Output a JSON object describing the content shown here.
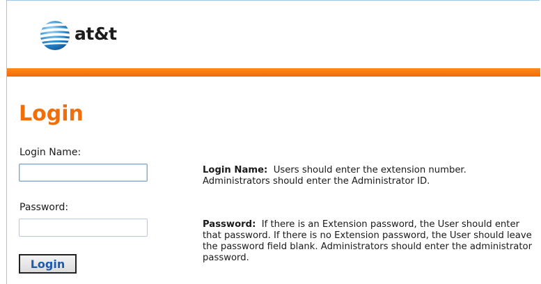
{
  "brand": {
    "logo_text": "at&t",
    "accent_color": "#f06f0b",
    "bar_color": "#f26b05",
    "link_color": "#1d5bb0"
  },
  "page": {
    "title": "Login"
  },
  "form": {
    "login_name_label": "Login Name:",
    "login_name_value": "",
    "password_label": "Password:",
    "password_value": "",
    "login_button_label": "Login"
  },
  "help": {
    "login_name_heading": "Login Name:",
    "login_name_text": "Users should enter the extension number. Administrators should enter the Administrator ID.",
    "password_heading": "Password:",
    "password_text": "If there is an Extension password, the User should enter that password. If there is no Extension password, the User should leave the password field blank. Administrators should enter the administrator password."
  }
}
